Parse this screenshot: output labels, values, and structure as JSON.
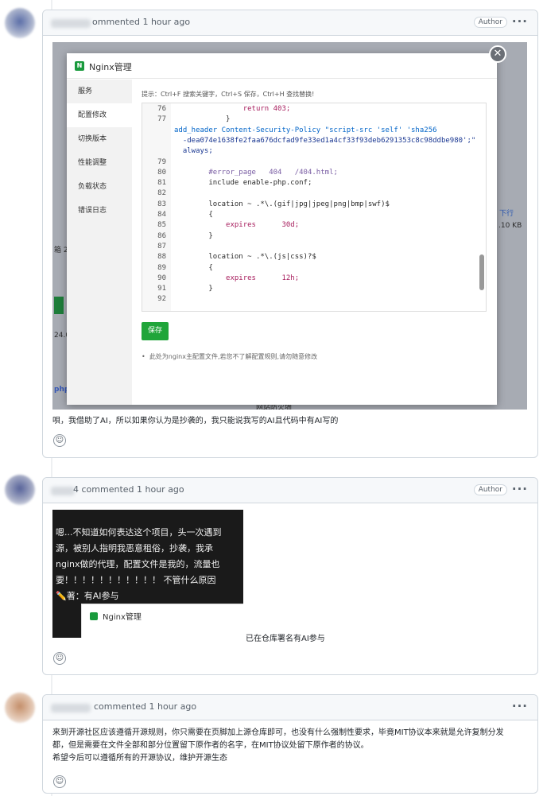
{
  "comments": [
    {
      "commented_text": "ommented 1 hour ago",
      "author_badge": "Author",
      "menu": "···",
      "screenshot": {
        "modal_title": "Nginx管理",
        "close": "✕",
        "sidebar": [
          "服务",
          "配置修改",
          "切换版本",
          "性能调整",
          "负载状态",
          "错误日志"
        ],
        "active_index": 1,
        "hint": "提示：Ctrl+F 搜索关键字，Ctrl+S 保存，Ctrl+H 查找替换!",
        "code_lines": [
          {
            "n": "76",
            "t": "                return 403;"
          },
          {
            "n": "77",
            "t": "            }"
          },
          {
            "n": "",
            "t": "add_header Content-Security-Policy \"script-src 'self' 'sha256"
          },
          {
            "n": "",
            "t": "  -dea074e1638fe2faa676dcfad9fe33ed1a4cf33f93deb6291353c8c98ddbe980';\""
          },
          {
            "n": "",
            "t": "  always;"
          },
          {
            "n": "79",
            "t": ""
          },
          {
            "n": "80",
            "t": "        #error_page   404   /404.html;"
          },
          {
            "n": "81",
            "t": "        include enable-php.conf;"
          },
          {
            "n": "82",
            "t": ""
          },
          {
            "n": "83",
            "t": "        location ~ .*\\.(gif|jpg|jpeg|png|bmp|swf)$"
          },
          {
            "n": "84",
            "t": "        {"
          },
          {
            "n": "85",
            "t": "            expires      30d;"
          },
          {
            "n": "86",
            "t": "        }"
          },
          {
            "n": "87",
            "t": ""
          },
          {
            "n": "88",
            "t": "        location ~ .*\\.(js|css)?$"
          },
          {
            "n": "89",
            "t": "        {"
          },
          {
            "n": "90",
            "t": "            expires      12h;"
          },
          {
            "n": "91",
            "t": "        }"
          },
          {
            "n": "92",
            "t": ""
          }
        ],
        "save_label": "保存",
        "note": "此处为nginx主配置文件,若您不了解配置规则,请勿随意修改",
        "bg_texts": [
          "箱 2",
          "24.0",
          "php",
          "下行",
          ".10 KB",
          "网站防火墙"
        ]
      },
      "body": "唄，我借助了AI，所以如果你认为是抄袭的，我只能说我写的AI且代码中有AI写的",
      "reaction_icon": "☺"
    },
    {
      "commented_text": "4 commented 1 hour ago",
      "author_badge": "Author",
      "menu": "···",
      "screenshot": {
        "lines": [
          "嗯...不知道如何表达这个项目，头一次遇到",
          "源，被别人指明我恶意租俗，抄袭，我承",
          "nginx做的代理，配置文件是我的，流量也",
          "要！！！！！！！！！！！ 不管什么原因",
          "✏️著：有AI参与"
        ],
        "inner_title": "Nginx管理"
      },
      "caption": "已在仓库署名有AI参与",
      "reaction_icon": "☺"
    },
    {
      "commented_text": "commented 1 hour ago",
      "menu": "···",
      "body_lines": [
        "来到开源社区应该遵循开源规则，你只需要在页脚加上源仓库即可，也没有什么强制性要求，毕竟MIT协议本来就是允许复制分发",
        "都，但是需要在文件全部和部分位置留下原作者的名字，在MIT协议处留下原作者的协议。",
        "希望今后可以遵循所有的开源协议，维护开源生态"
      ],
      "reaction_icon": "☺"
    }
  ]
}
